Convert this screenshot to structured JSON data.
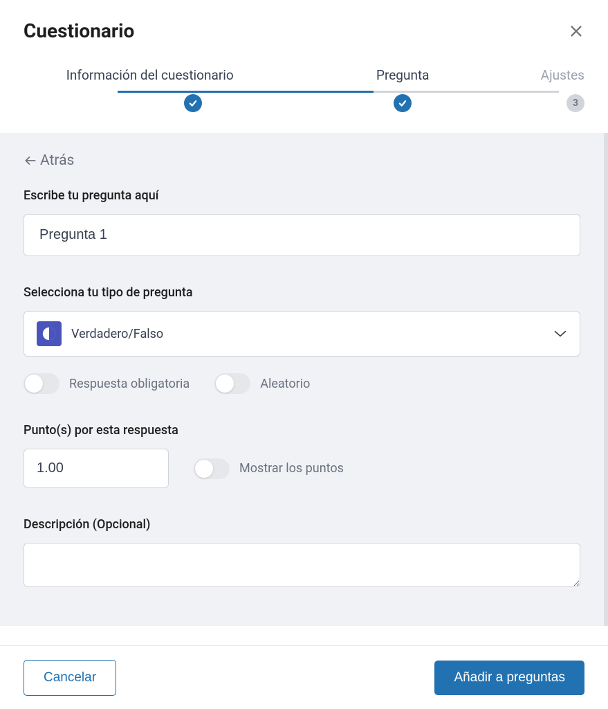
{
  "modal": {
    "title": "Cuestionario"
  },
  "stepper": {
    "steps": [
      {
        "label": "Información del cuestionario",
        "state": "done"
      },
      {
        "label": "Pregunta",
        "state": "done"
      },
      {
        "label": "Ajustes",
        "state": "pending",
        "number": "3"
      }
    ]
  },
  "back": {
    "label": "Atrás"
  },
  "fields": {
    "question_label": "Escribe tu pregunta aquí",
    "question_value": "Pregunta 1",
    "type_label": "Selecciona tu tipo de pregunta",
    "type_value": "Verdadero/Falso",
    "required_label": "Respuesta obligatoria",
    "random_label": "Aleatorio",
    "points_label": "Punto(s) por esta respuesta",
    "points_value": "1.00",
    "show_points_label": "Mostrar los puntos",
    "description_label": "Descripción (Opcional)"
  },
  "footer": {
    "cancel": "Cancelar",
    "add": "Añadir a preguntas"
  }
}
